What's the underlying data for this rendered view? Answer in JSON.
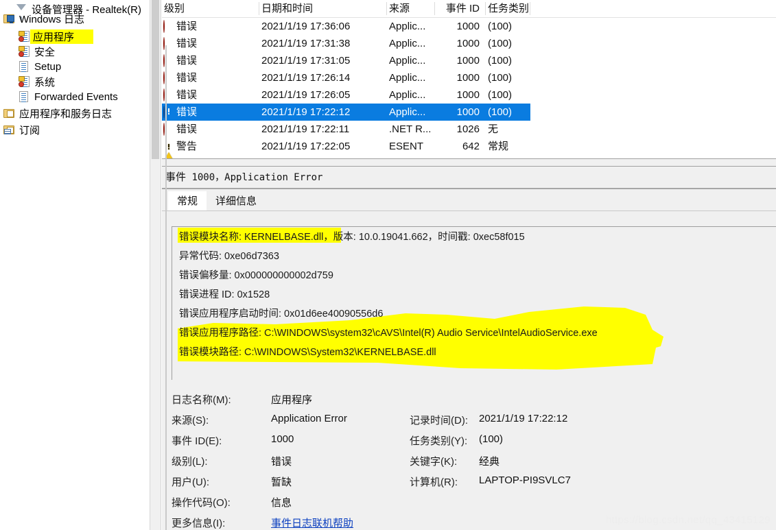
{
  "tree": {
    "items": [
      {
        "label": "设备管理器 - Realtek(R)",
        "icon": "funnel-icon",
        "indent": 22,
        "highlighted": false
      },
      {
        "label": "Windows 日志",
        "icon": "folder-monitor-icon",
        "indent": 4,
        "highlighted": false
      },
      {
        "label": "应用程序",
        "icon": "log-admin-icon",
        "indent": 26,
        "highlighted": true
      },
      {
        "label": "安全",
        "icon": "log-admin-icon",
        "indent": 26,
        "highlighted": false
      },
      {
        "label": "Setup",
        "icon": "log-page-icon",
        "indent": 26,
        "highlighted": false
      },
      {
        "label": "系统",
        "icon": "log-admin-icon",
        "indent": 26,
        "highlighted": false
      },
      {
        "label": "Forwarded Events",
        "icon": "log-page-icon",
        "indent": 26,
        "highlighted": false
      },
      {
        "label": "应用程序和服务日志",
        "icon": "folder-icon",
        "indent": 4,
        "highlighted": false
      },
      {
        "label": "订阅",
        "icon": "folder-grid-icon",
        "indent": 4,
        "highlighted": false
      }
    ]
  },
  "list": {
    "columns": [
      {
        "label": "级别",
        "align": "left"
      },
      {
        "label": "日期和时间",
        "align": "left"
      },
      {
        "label": "来源",
        "align": "left"
      },
      {
        "label": "事件 ID",
        "align": "right"
      },
      {
        "label": "任务类别",
        "align": "left"
      }
    ],
    "rows": [
      {
        "level": "错误",
        "level_icon": "error-icon",
        "datetime": "2021/1/19 17:36:06",
        "source": "Applic...",
        "event_id": "1000",
        "task": "(100)",
        "selected": false
      },
      {
        "level": "错误",
        "level_icon": "error-icon",
        "datetime": "2021/1/19 17:31:38",
        "source": "Applic...",
        "event_id": "1000",
        "task": "(100)",
        "selected": false
      },
      {
        "level": "错误",
        "level_icon": "error-icon",
        "datetime": "2021/1/19 17:31:05",
        "source": "Applic...",
        "event_id": "1000",
        "task": "(100)",
        "selected": false
      },
      {
        "level": "错误",
        "level_icon": "error-icon",
        "datetime": "2021/1/19 17:26:14",
        "source": "Applic...",
        "event_id": "1000",
        "task": "(100)",
        "selected": false
      },
      {
        "level": "错误",
        "level_icon": "error-icon",
        "datetime": "2021/1/19 17:26:05",
        "source": "Applic...",
        "event_id": "1000",
        "task": "(100)",
        "selected": false
      },
      {
        "level": "错误",
        "level_icon": "error-icon",
        "datetime": "2021/1/19 17:22:12",
        "source": "Applic...",
        "event_id": "1000",
        "task": "(100)",
        "selected": true
      },
      {
        "level": "错误",
        "level_icon": "error-icon",
        "datetime": "2021/1/19 17:22:11",
        "source": ".NET R...",
        "event_id": "1026",
        "task": "无",
        "selected": false
      },
      {
        "level": "警告",
        "level_icon": "warning-icon",
        "datetime": "2021/1/19 17:22:05",
        "source": "ESENT",
        "event_id": "642",
        "task": "常规",
        "selected": false
      }
    ]
  },
  "detail": {
    "title_prefix": "事件",
    "title_rest": " 1000，Application Error",
    "tabs": [
      {
        "label": "常规",
        "active": true
      },
      {
        "label": "详细信息",
        "active": false
      }
    ],
    "message_lines": [
      "错误模块名称: KERNELBASE.dll，版本: 10.0.19041.662，时间戳: 0xec58f015",
      "异常代码: 0xe06d7363",
      "错误偏移量: 0x000000000002d759",
      "错误进程 ID: 0x1528",
      "错误应用程序启动时间: 0x01d6ee40090556d6",
      "错误应用程序路径: C:\\WINDOWS\\system32\\cAVS\\Intel(R) Audio Service\\IntelAudioService.exe",
      "错误模块路径: C:\\WINDOWS\\System32\\KERNELBASE.dll"
    ],
    "fields_left": [
      {
        "label": "日志名称(M):",
        "value": "应用程序"
      },
      {
        "label": "来源(S):",
        "value": "Application Error"
      },
      {
        "label": "事件 ID(E):",
        "value": "1000"
      },
      {
        "label": "级别(L):",
        "value": "错误"
      },
      {
        "label": "用户(U):",
        "value": "暂缺"
      },
      {
        "label": "操作代码(O):",
        "value": "信息"
      },
      {
        "label": "更多信息(I):",
        "value": "事件日志联机帮助",
        "is_link": true
      }
    ],
    "fields_right": [
      {
        "label": "记录时间(D):",
        "value": "2021/1/19 17:22:12"
      },
      {
        "label": "任务类别(Y):",
        "value": "(100)"
      },
      {
        "label": "关键字(K):",
        "value": "经典"
      },
      {
        "label": "计算机(R):",
        "value": "LAPTOP-PI9SVLC7"
      }
    ]
  },
  "watermark": {
    "text": "https://blog.csdn.net/qq_43415129"
  },
  "colors": {
    "selection": "#0a7ce0",
    "highlighter": "#ffff00",
    "error_red": "#d9342a",
    "warning_yellow": "#f2c41a",
    "link_blue": "#0b3fbf"
  }
}
